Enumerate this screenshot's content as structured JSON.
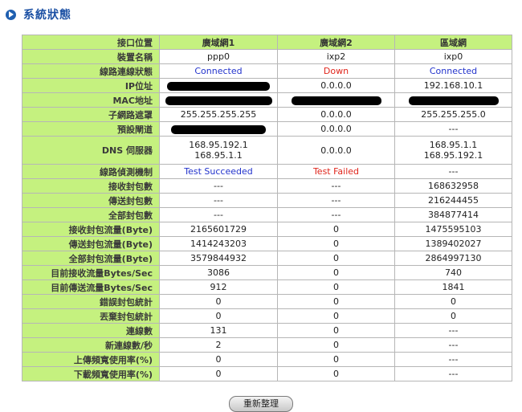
{
  "header": {
    "title": "系統狀態"
  },
  "table": {
    "corner": "接口位置",
    "columns": [
      "廣域網1",
      "廣域網2",
      "區域網"
    ],
    "rows": [
      {
        "label": "裝置名稱",
        "values": [
          "ppp0",
          "ixp2",
          "ixp0"
        ]
      },
      {
        "label": "線路連線狀態",
        "values": [
          "Connected",
          "Down",
          "Connected"
        ]
      },
      {
        "label": "IP位址",
        "values": [
          "",
          "0.0.0.0",
          "192.168.10.1"
        ]
      },
      {
        "label": "MAC地址",
        "values": [
          "",
          "",
          ""
        ]
      },
      {
        "label": "子網路遮罩",
        "values": [
          "255.255.255.255",
          "0.0.0.0",
          "255.255.255.0"
        ]
      },
      {
        "label": "預設閘道",
        "values": [
          "",
          "0.0.0.0",
          "---"
        ]
      },
      {
        "label": "DNS 伺服器",
        "values": [
          "168.95.192.1",
          "168.95.1.1",
          "0.0.0.0",
          "168.95.1.1",
          "168.95.192.1"
        ]
      },
      {
        "label": "線路偵測機制",
        "values": [
          "Test Succeeded",
          "Test Failed",
          "---"
        ]
      },
      {
        "label": "接收封包數",
        "values": [
          "---",
          "---",
          "168632958"
        ]
      },
      {
        "label": "傳送封包數",
        "values": [
          "---",
          "---",
          "216244455"
        ]
      },
      {
        "label": "全部封包數",
        "values": [
          "---",
          "---",
          "384877414"
        ]
      },
      {
        "label": "接收封包流量(Byte)",
        "values": [
          "2165601729",
          "0",
          "1475595103"
        ]
      },
      {
        "label": "傳送封包流量(Byte)",
        "values": [
          "1414243203",
          "0",
          "1389402027"
        ]
      },
      {
        "label": "全部封包流量(Byte)",
        "values": [
          "3579844932",
          "0",
          "2864997130"
        ]
      },
      {
        "label": "目前接收流量Bytes/Sec",
        "values": [
          "3086",
          "0",
          "740"
        ]
      },
      {
        "label": "目前傳送流量Bytes/Sec",
        "values": [
          "912",
          "0",
          "1841"
        ]
      },
      {
        "label": "錯誤封包統計",
        "values": [
          "0",
          "0",
          "0"
        ]
      },
      {
        "label": "丟棄封包統計",
        "values": [
          "0",
          "0",
          "0"
        ]
      },
      {
        "label": "連線數",
        "values": [
          "131",
          "0",
          "---"
        ]
      },
      {
        "label": "新連線數/秒",
        "values": [
          "2",
          "0",
          "---"
        ]
      },
      {
        "label": "上傳頻寬使用率(%)",
        "values": [
          "0",
          "0",
          "---"
        ]
      },
      {
        "label": "下載頻寬使用率(%)",
        "values": [
          "0",
          "0",
          "---"
        ]
      }
    ]
  },
  "colors": {
    "label_bg": "#c5f17f",
    "title": "#1a4fa3",
    "ok": "#2233cc",
    "fail": "#e0261c"
  },
  "icons": {
    "header": "arrow-right-circle-icon"
  },
  "refresh_button": "重新整理"
}
